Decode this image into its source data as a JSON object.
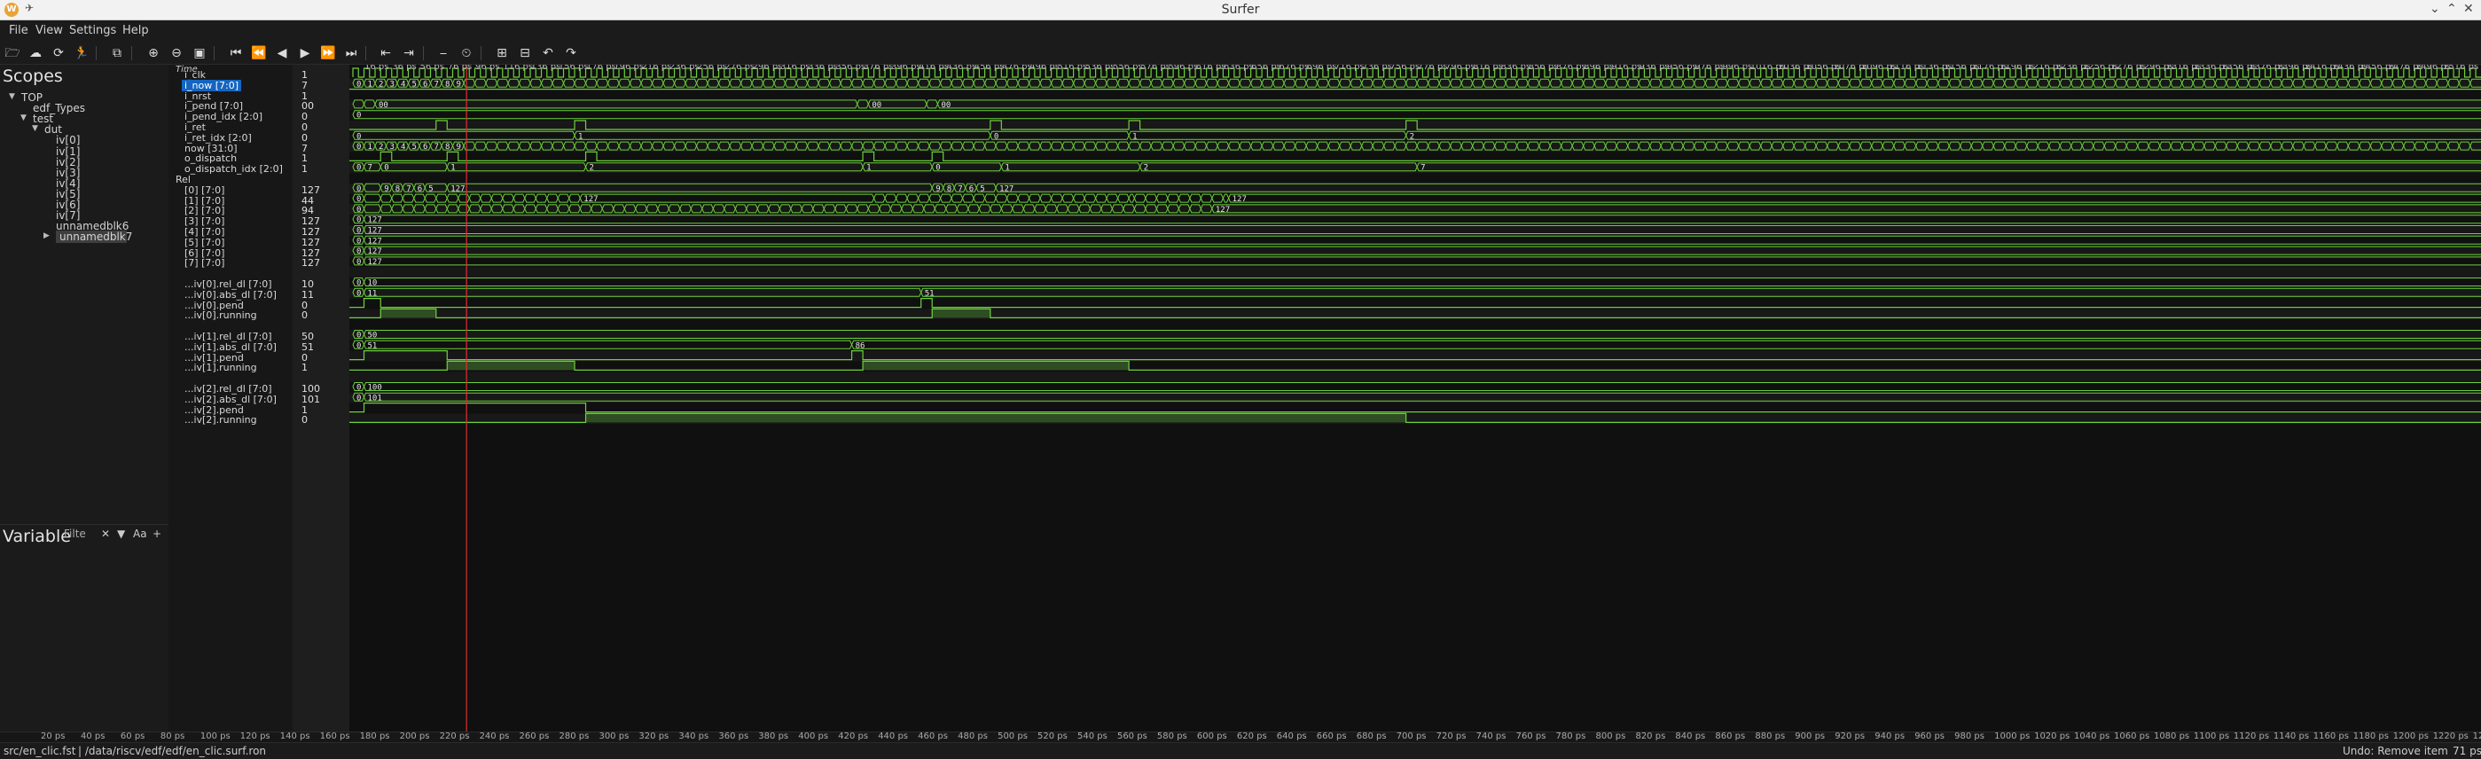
{
  "window": {
    "title": "Surfer",
    "logo_letter": "W"
  },
  "menu": [
    "File",
    "View",
    "Settings",
    "Help"
  ],
  "toolbar_icons": [
    "open-file-icon",
    "open-url-icon",
    "reload-icon",
    "run-icon",
    "copy-icon",
    "zoom-in-icon",
    "zoom-out-icon",
    "zoom-fit-icon",
    "go-to-start-icon",
    "fast-rewind-icon",
    "step-back-icon",
    "play-icon",
    "fast-forward-icon",
    "go-to-end-icon",
    "prev-transition-icon",
    "next-transition-icon",
    "divider-icon",
    "timer-icon",
    "add-marker-icon",
    "delete-marker-icon",
    "undo-icon",
    "redo-icon"
  ],
  "scopes": {
    "header": "Scopes",
    "items": [
      {
        "label": "TOP",
        "indent": 0,
        "tri": "▼"
      },
      {
        "label": "edf_Types",
        "indent": 1,
        "tri": ""
      },
      {
        "label": "test",
        "indent": 1,
        "tri": "▼"
      },
      {
        "label": "dut",
        "indent": 2,
        "tri": "▼"
      },
      {
        "label": "iv[0]",
        "indent": 3,
        "tri": ""
      },
      {
        "label": "iv[1]",
        "indent": 3,
        "tri": ""
      },
      {
        "label": "iv[2]",
        "indent": 3,
        "tri": ""
      },
      {
        "label": "iv[3]",
        "indent": 3,
        "tri": ""
      },
      {
        "label": "iv[4]",
        "indent": 3,
        "tri": ""
      },
      {
        "label": "iv[5]",
        "indent": 3,
        "tri": ""
      },
      {
        "label": "iv[6]",
        "indent": 3,
        "tri": ""
      },
      {
        "label": "iv[7]",
        "indent": 3,
        "tri": ""
      },
      {
        "label": "unnamedblk6",
        "indent": 3,
        "tri": ""
      },
      {
        "label": "unnamedblk7",
        "indent": 3,
        "tri": "▶",
        "sel": true
      }
    ]
  },
  "variables": {
    "header": "Variable",
    "filter_placeholder": "Filte"
  },
  "time_label": "Time",
  "time_axis": {
    "unit": "ps",
    "start": -4,
    "step": 20,
    "count": 80
  },
  "bottom_axis": {
    "start": 20,
    "step": 20,
    "count": 62
  },
  "cursor_time": 82,
  "signals": [
    {
      "name": "i_clk",
      "value": "1",
      "kind": "clock"
    },
    {
      "name": "i_now [7:0]",
      "value": "7",
      "kind": "counter",
      "sel": true
    },
    {
      "name": "i_nrst",
      "value": "1",
      "kind": "bit",
      "high": true
    },
    {
      "name": "i_pend [7:0]",
      "value": "00",
      "kind": "bus",
      "seg": [
        [
          0,
          "00"
        ],
        [
          8,
          "07"
        ],
        [
          16,
          "00"
        ],
        [
          364,
          "02"
        ],
        [
          372,
          "00"
        ],
        [
          414,
          "01"
        ],
        [
          422,
          "00"
        ]
      ]
    },
    {
      "name": "i_pend_idx [2:0]",
      "value": "0",
      "kind": "bus",
      "seg": [
        [
          0,
          "0"
        ]
      ]
    },
    {
      "name": "i_ret",
      "value": "0",
      "kind": "pulses",
      "pulses": [
        [
          60,
          68
        ],
        [
          160,
          168
        ],
        [
          460,
          468
        ],
        [
          560,
          568
        ],
        [
          760,
          768
        ]
      ]
    },
    {
      "name": "i_ret_idx [2:0]",
      "value": "0",
      "kind": "bus",
      "seg": [
        [
          0,
          "0"
        ],
        [
          160,
          "1"
        ],
        [
          460,
          "0"
        ],
        [
          560,
          "1"
        ],
        [
          760,
          "2"
        ]
      ]
    },
    {
      "name": "now [31:0]",
      "value": "7",
      "kind": "counter"
    },
    {
      "name": "o_dispatch",
      "value": "1",
      "kind": "pulses",
      "pulses": [
        [
          20,
          28
        ],
        [
          68,
          76
        ],
        [
          168,
          176
        ],
        [
          368,
          376
        ],
        [
          418,
          426
        ]
      ]
    },
    {
      "name": "o_dispatch_idx [2:0]",
      "value": "1",
      "kind": "bus",
      "seg": [
        [
          0,
          "0"
        ],
        [
          8,
          "7"
        ],
        [
          20,
          "0"
        ],
        [
          68,
          "1"
        ],
        [
          168,
          "2"
        ],
        [
          368,
          "1"
        ],
        [
          418,
          "0"
        ],
        [
          468,
          "1"
        ],
        [
          568,
          "2"
        ],
        [
          768,
          "7"
        ]
      ]
    },
    {
      "name": "Rel",
      "value": "",
      "kind": "group"
    },
    {
      "name": "[0] [7:0]",
      "value": "127",
      "kind": "bus",
      "seg": [
        [
          0,
          "0"
        ],
        [
          8,
          "127"
        ],
        [
          20,
          "9"
        ],
        [
          28,
          "8"
        ],
        [
          36,
          "7"
        ],
        [
          44,
          "6"
        ],
        [
          52,
          "5"
        ],
        [
          68,
          "127"
        ],
        [
          418,
          "9"
        ],
        [
          426,
          "8"
        ],
        [
          434,
          "7"
        ],
        [
          442,
          "6"
        ],
        [
          450,
          "5"
        ],
        [
          464,
          "127"
        ]
      ]
    },
    {
      "name": "[1] [7:0]",
      "value": "44",
      "kind": "countdown",
      "start": 127,
      "first": 50,
      "phases": [
        [
          20,
          50,
          68
        ],
        [
          68,
          35,
          164
        ],
        [
          164,
          127,
          376
        ],
        [
          376,
          49,
          564
        ],
        [
          564,
          31,
          632
        ],
        [
          632,
          127,
          9999
        ]
      ]
    },
    {
      "name": "[2] [7:0]",
      "value": "94",
      "kind": "countdown2"
    },
    {
      "name": "[3] [7:0]",
      "value": "127",
      "kind": "bus",
      "seg": [
        [
          0,
          "0"
        ],
        [
          8,
          "127"
        ]
      ]
    },
    {
      "name": "[4] [7:0]",
      "value": "127",
      "kind": "bus",
      "seg": [
        [
          0,
          "0"
        ],
        [
          8,
          "127"
        ]
      ]
    },
    {
      "name": "[5] [7:0]",
      "value": "127",
      "kind": "bus",
      "seg": [
        [
          0,
          "0"
        ],
        [
          8,
          "127"
        ]
      ]
    },
    {
      "name": "[6] [7:0]",
      "value": "127",
      "kind": "bus",
      "seg": [
        [
          0,
          "0"
        ],
        [
          8,
          "127"
        ]
      ]
    },
    {
      "name": "[7] [7:0]",
      "value": "127",
      "kind": "bus",
      "seg": [
        [
          0,
          "0"
        ],
        [
          8,
          "127"
        ]
      ]
    },
    {
      "name": "",
      "value": "",
      "kind": "blank"
    },
    {
      "name": "...iv[0].rel_dl [7:0]",
      "value": "10",
      "kind": "bus",
      "seg": [
        [
          0,
          "0"
        ],
        [
          8,
          "10"
        ]
      ]
    },
    {
      "name": "...iv[0].abs_dl [7:0]",
      "value": "11",
      "kind": "bus",
      "seg": [
        [
          0,
          "0"
        ],
        [
          8,
          "11"
        ],
        [
          410,
          "51"
        ]
      ]
    },
    {
      "name": "...iv[0].pend",
      "value": "0",
      "kind": "pulses",
      "pulses": [
        [
          8,
          20
        ],
        [
          410,
          418
        ]
      ]
    },
    {
      "name": "...iv[0].running",
      "value": "0",
      "kind": "fills",
      "pulses": [
        [
          20,
          60
        ],
        [
          418,
          460
        ]
      ]
    },
    {
      "name": "",
      "value": "",
      "kind": "blank"
    },
    {
      "name": "...iv[1].rel_dl [7:0]",
      "value": "50",
      "kind": "bus",
      "seg": [
        [
          0,
          "0"
        ],
        [
          8,
          "50"
        ]
      ]
    },
    {
      "name": "...iv[1].abs_dl [7:0]",
      "value": "51",
      "kind": "bus",
      "seg": [
        [
          0,
          "0"
        ],
        [
          8,
          "51"
        ],
        [
          360,
          "86"
        ]
      ]
    },
    {
      "name": "...iv[1].pend",
      "value": "0",
      "kind": "pulses",
      "pulses": [
        [
          8,
          68
        ],
        [
          360,
          368
        ]
      ]
    },
    {
      "name": "...iv[1].running",
      "value": "1",
      "kind": "fills",
      "pulses": [
        [
          68,
          160
        ],
        [
          368,
          560
        ]
      ]
    },
    {
      "name": "",
      "value": "",
      "kind": "blank"
    },
    {
      "name": "...iv[2].rel_dl [7:0]",
      "value": "100",
      "kind": "bus",
      "seg": [
        [
          0,
          "0"
        ],
        [
          8,
          "100"
        ]
      ]
    },
    {
      "name": "...iv[2].abs_dl [7:0]",
      "value": "101",
      "kind": "bus",
      "seg": [
        [
          0,
          "0"
        ],
        [
          8,
          "101"
        ]
      ]
    },
    {
      "name": "...iv[2].pend",
      "value": "1",
      "kind": "pulses",
      "pulses": [
        [
          8,
          168
        ]
      ]
    },
    {
      "name": "...iv[2].running",
      "value": "0",
      "kind": "fills",
      "pulses": [
        [
          168,
          760
        ]
      ]
    }
  ],
  "status": {
    "file": "src/en_clic.fst",
    "state": "| /data/riscv/edf/edf/en_clic.surf.ron",
    "undo": "Undo: Remove item",
    "time": "71 ps"
  },
  "colors": {
    "wave": "#6dd13c",
    "cursor": "#e03030",
    "selected": "#1565c0"
  }
}
